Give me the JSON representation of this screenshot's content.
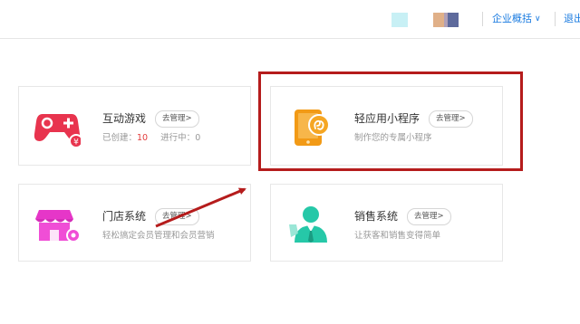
{
  "topbar": {
    "enterprise_menu_label": "企业概括",
    "logout_label": "退出",
    "avatar_colors": [
      "#c8f0f5",
      "#ffffff",
      "#e8b58c",
      "#cdb5c8",
      "#5e6a9c"
    ]
  },
  "cards": {
    "games": {
      "title": "互动游戏",
      "manage_label": "去管理>",
      "created_label": "已创建：",
      "created_count": "10",
      "in_progress_label": "进行中：",
      "in_progress_count": "0",
      "icon": "gamepad-icon",
      "color": "#e8344e"
    },
    "mini_program": {
      "title": "轻应用小程序",
      "manage_label": "去管理>",
      "desc": "制作您的专属小程序",
      "icon": "mobile-miniprogram-icon",
      "color": "#f29a16"
    },
    "store": {
      "title": "门店系统",
      "manage_label": "去管理>",
      "desc": "轻松搞定会员管理和会员营销",
      "icon": "storefront-icon",
      "color": "#e636c8"
    },
    "sales": {
      "title": "销售系统",
      "manage_label": "去管理>",
      "desc": "让获客和销售变得简单",
      "icon": "salesperson-icon",
      "color": "#26c8a8"
    }
  },
  "annotation": {
    "highlight_color": "#b51c1c"
  }
}
